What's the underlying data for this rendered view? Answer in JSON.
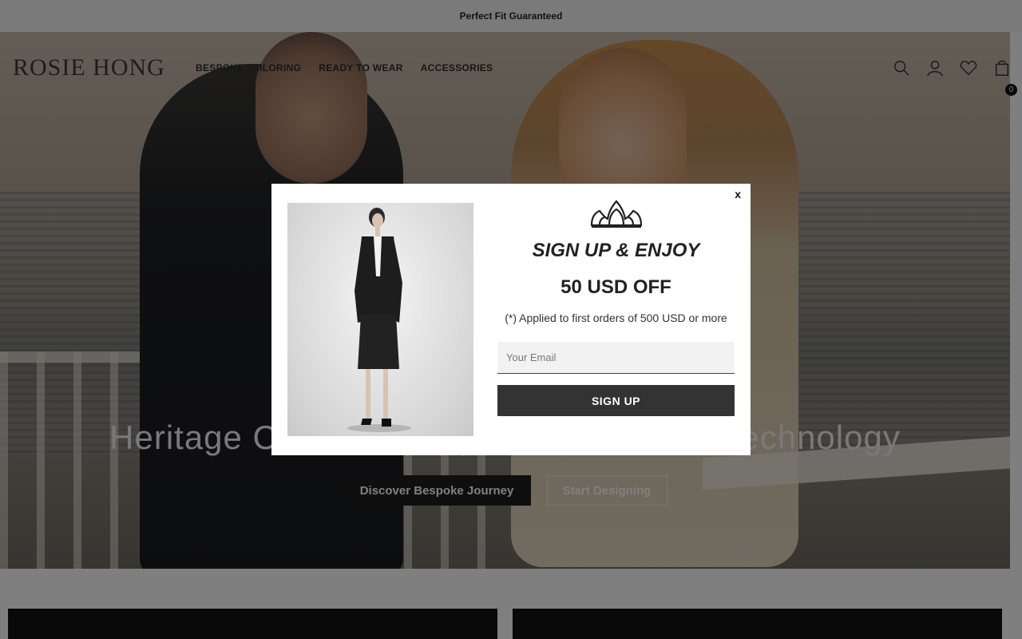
{
  "announcement": {
    "text": "Perfect Fit Guaranteed"
  },
  "header": {
    "logo": "ROSIE HONG",
    "nav": [
      "BESPOKE TAILORING",
      "READY TO WEAR",
      "ACCESSORIES"
    ],
    "icons": [
      "search-icon",
      "account-icon",
      "wishlist-icon",
      "cart-icon"
    ],
    "cart_count": "0"
  },
  "hero": {
    "title": "Heritage Craftsmanship Meets Modern Technology",
    "primary_button": "Discover Bespoke Journey",
    "secondary_button": "Start Designing"
  },
  "modal": {
    "close_label": "x",
    "heading": "SIGN UP & ENJOY",
    "offer": "50 USD OFF",
    "note": "(*) Applied to first orders of 500 USD or more",
    "email_placeholder": "Your Email",
    "email_value": "",
    "submit_label": "SIGN UP"
  },
  "colors": {
    "overlay": "#000000",
    "button_dark": "#333333",
    "announcement_bg": "#f4f4f4"
  }
}
